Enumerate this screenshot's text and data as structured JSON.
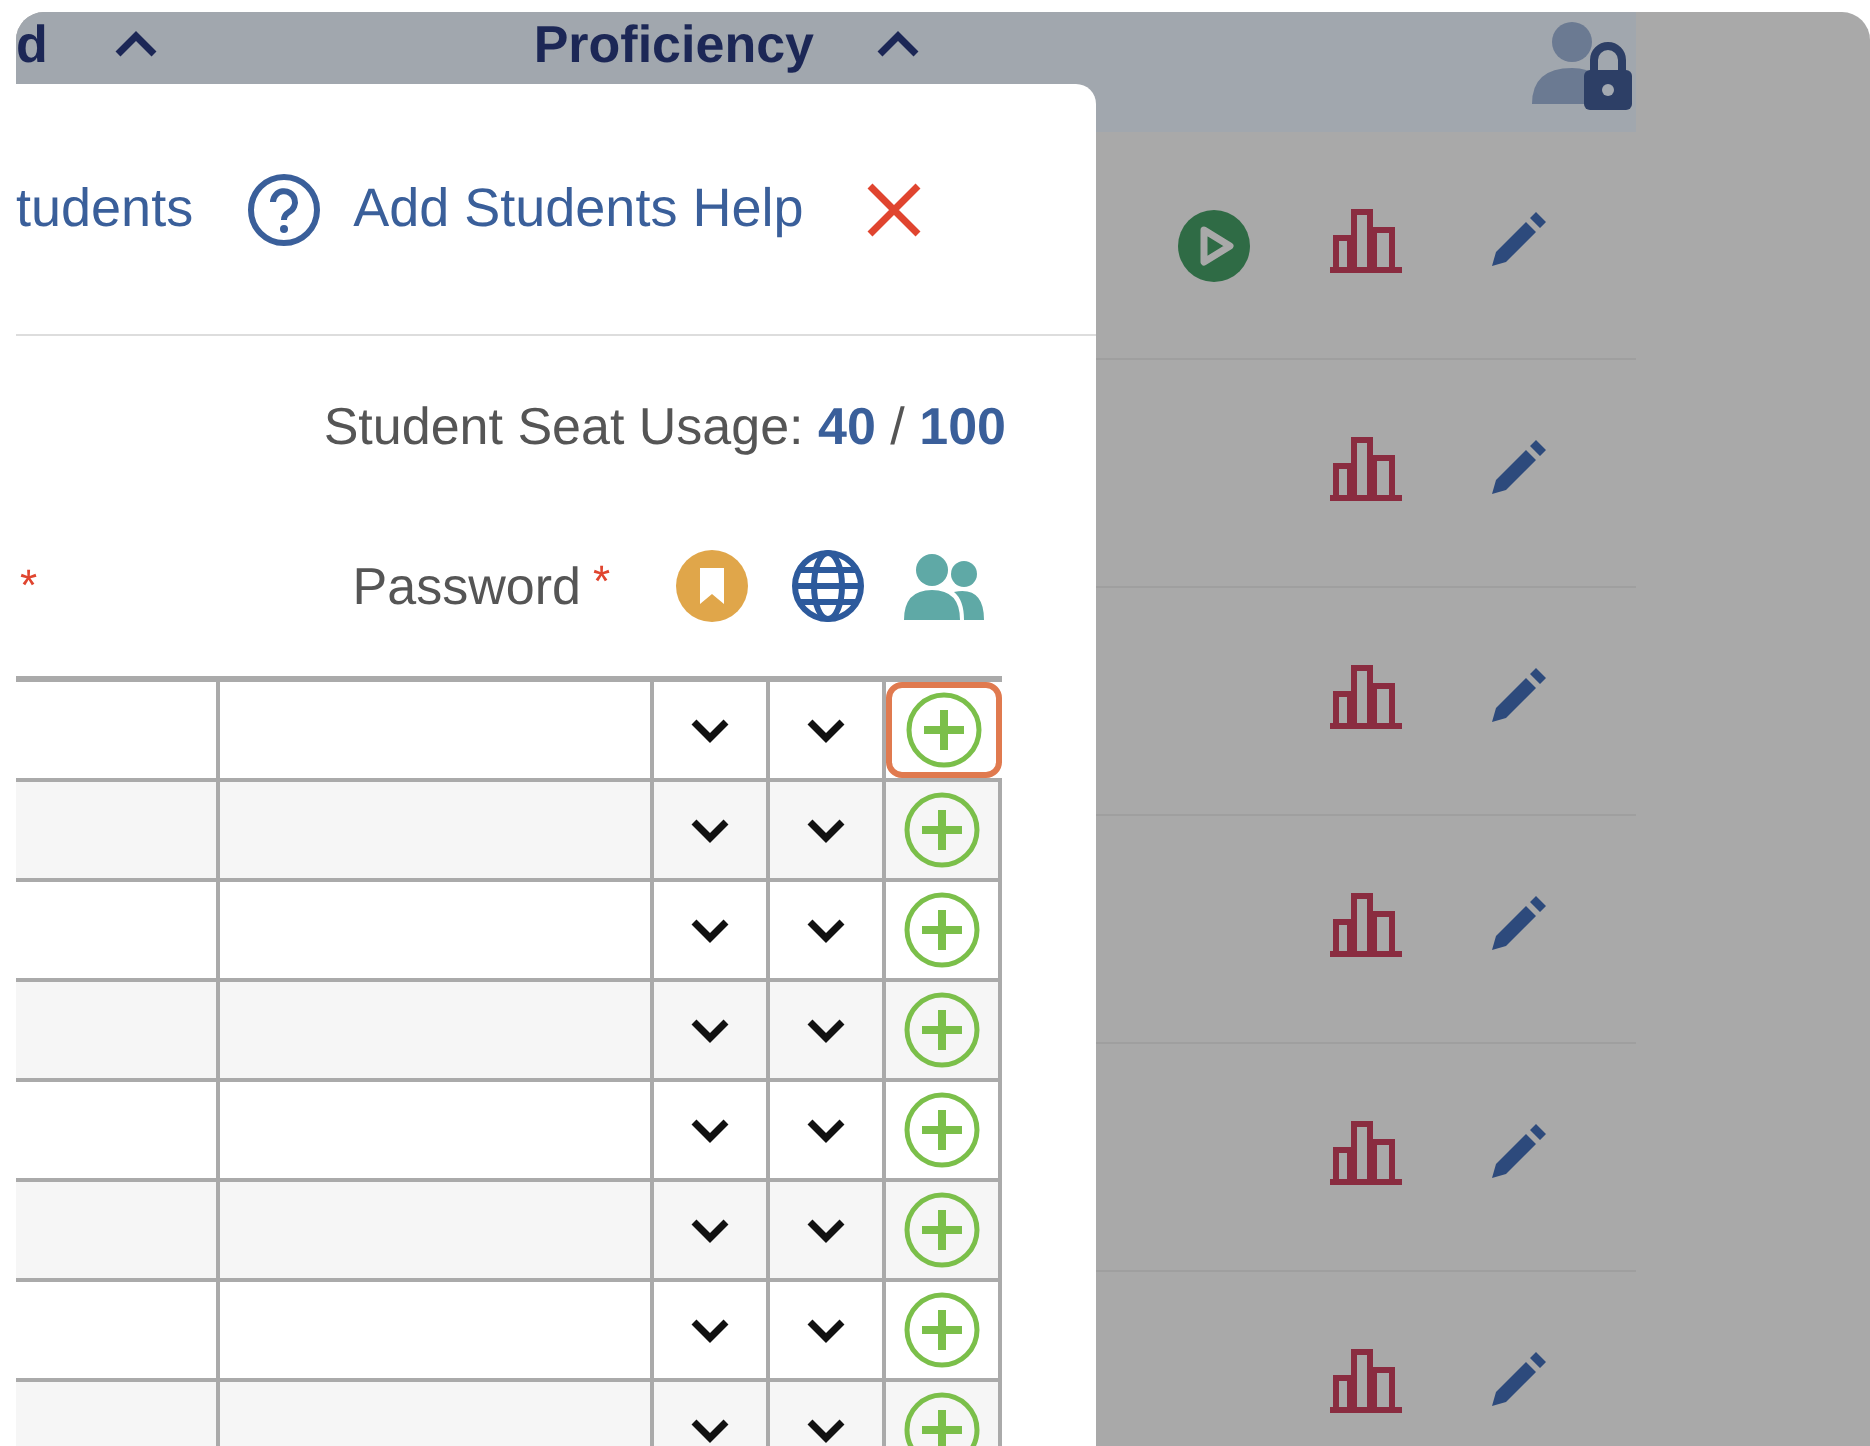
{
  "background_table": {
    "columns": [
      {
        "label": "d",
        "sorted_ascending": true
      },
      {
        "label": "Proficiency",
        "sorted_ascending": true
      }
    ],
    "rows": [
      {
        "playable": true
      },
      {
        "playable": false
      },
      {
        "playable": false
      },
      {
        "playable": false
      },
      {
        "playable": false
      },
      {
        "playable": false
      }
    ]
  },
  "modal": {
    "header": {
      "link": "tudents",
      "help": "Add Students Help"
    },
    "seat_usage": "Student Seat Usage: **40** / **100**",
    "columns": [
      {
        "kind": "text",
        "mark": "*"
      },
      {
        "kind": "text",
        "label": "Password",
        "mark": "*"
      },
      {
        "kind": "bookmark"
      },
      {
        "kind": "globe"
      },
      {
        "kind": "group"
      }
    ],
    "rows": [
      {
        "highlighted": true
      },
      {
        "highlighted": false
      },
      {
        "highlighted": false
      },
      {
        "highlighted": false
      },
      {
        "highlighted": false
      },
      {
        "highlighted": false
      },
      {
        "highlighted": false
      },
      {
        "highlighted": false
      }
    ]
  }
}
